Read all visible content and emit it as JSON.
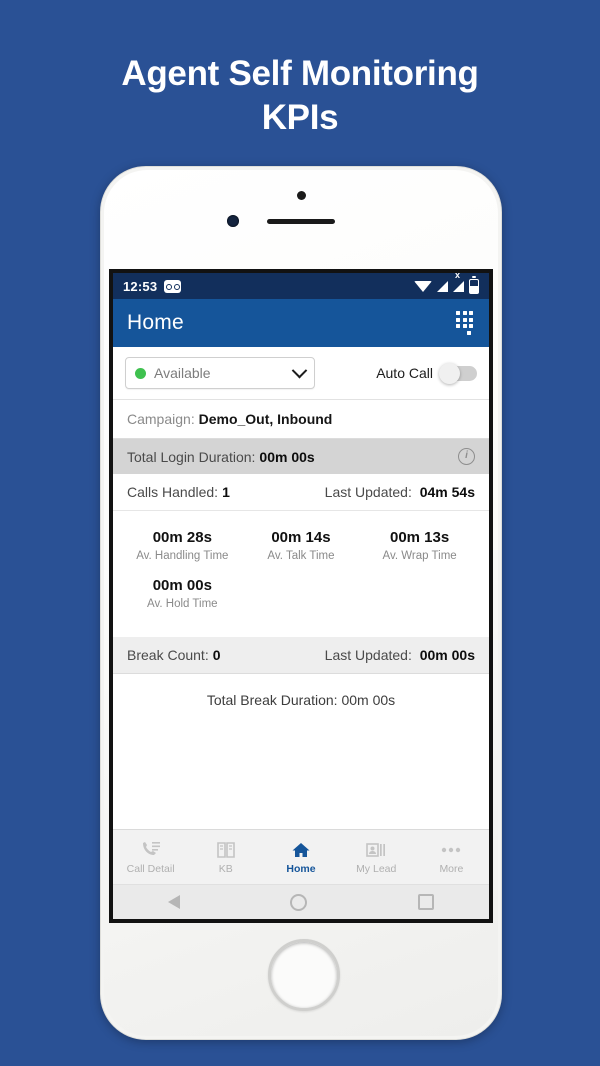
{
  "promo": {
    "title_line1": "Agent Self Monitoring",
    "title_line2": "KPIs",
    "background_color": "#2a5195"
  },
  "status_bar": {
    "time": "12:53",
    "icons": [
      "infinity-badge-icon",
      "wifi-icon",
      "signal-icon",
      "signal-no-service-icon",
      "battery-icon"
    ]
  },
  "app_bar": {
    "title": "Home",
    "action_icon": "dialpad-icon",
    "color": "#15559a"
  },
  "agent_status": {
    "selected": "Available",
    "dot_color": "#3fc14f",
    "auto_call_label": "Auto Call",
    "auto_call_state": "off"
  },
  "campaign": {
    "label": "Campaign:",
    "value": "Demo_Out, Inbound"
  },
  "login": {
    "label": "Total Login Duration:",
    "value": "00m 00s",
    "info_icon": "i"
  },
  "calls": {
    "handled_label": "Calls Handled:",
    "handled_value": "1",
    "updated_label": "Last Updated:",
    "updated_value": "04m 54s"
  },
  "metrics": [
    {
      "value": "00m 28s",
      "label": "Av. Handling Time"
    },
    {
      "value": "00m 14s",
      "label": "Av. Talk Time"
    },
    {
      "value": "00m 13s",
      "label": "Av. Wrap Time"
    },
    {
      "value": "00m 00s",
      "label": "Av. Hold Time"
    }
  ],
  "breaks": {
    "count_label": "Break Count:",
    "count_value": "0",
    "updated_label": "Last Updated:",
    "updated_value": "00m 00s",
    "total_text": "Total Break Duration: 00m 00s"
  },
  "bottom_nav": {
    "items": [
      {
        "label": "Call Detail",
        "icon": "call-detail-icon",
        "active": false
      },
      {
        "label": "KB",
        "icon": "book-icon",
        "active": false
      },
      {
        "label": "Home",
        "icon": "home-icon",
        "active": true
      },
      {
        "label": "My Lead",
        "icon": "contact-card-icon",
        "active": false
      },
      {
        "label": "More",
        "icon": "more-dots-icon",
        "active": false
      }
    ],
    "active_color": "#15559a"
  },
  "android_nav": {
    "back": "back-triangle-icon",
    "home": "home-circle-icon",
    "recents": "recents-square-icon"
  }
}
